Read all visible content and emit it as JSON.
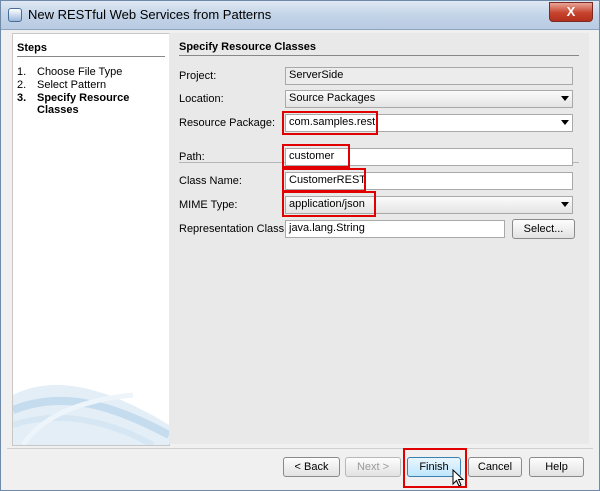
{
  "window": {
    "title": "New RESTful Web Services from Patterns",
    "close_glyph": "X"
  },
  "steps": {
    "title": "Steps",
    "items": [
      {
        "num": "1.",
        "label": "Choose File Type"
      },
      {
        "num": "2.",
        "label": "Select Pattern"
      },
      {
        "num": "3.",
        "label": "Specify Resource",
        "label2": "Classes"
      }
    ]
  },
  "panel": {
    "title": "Specify Resource Classes",
    "project": {
      "label": "Project:",
      "value": "ServerSide"
    },
    "location": {
      "label": "Location:",
      "value": "Source Packages"
    },
    "resource_package": {
      "label": "Resource Package:",
      "value": "com.samples.rest"
    },
    "path": {
      "label": "Path:",
      "value": "customer"
    },
    "class_name": {
      "label": "Class Name:",
      "value": "CustomerREST"
    },
    "mime_type": {
      "label": "MIME Type:",
      "value": "application/json"
    },
    "representation_class": {
      "label": "Representation Class:",
      "value": "java.lang.String",
      "select_button": "Select..."
    }
  },
  "buttons": {
    "back": "< Back",
    "next": "Next >",
    "finish": "Finish",
    "cancel": "Cancel",
    "help": "Help"
  },
  "colors": {
    "highlight": "#e10000",
    "title_bar": "#c3d4e8",
    "close_button": "#c7432e"
  }
}
